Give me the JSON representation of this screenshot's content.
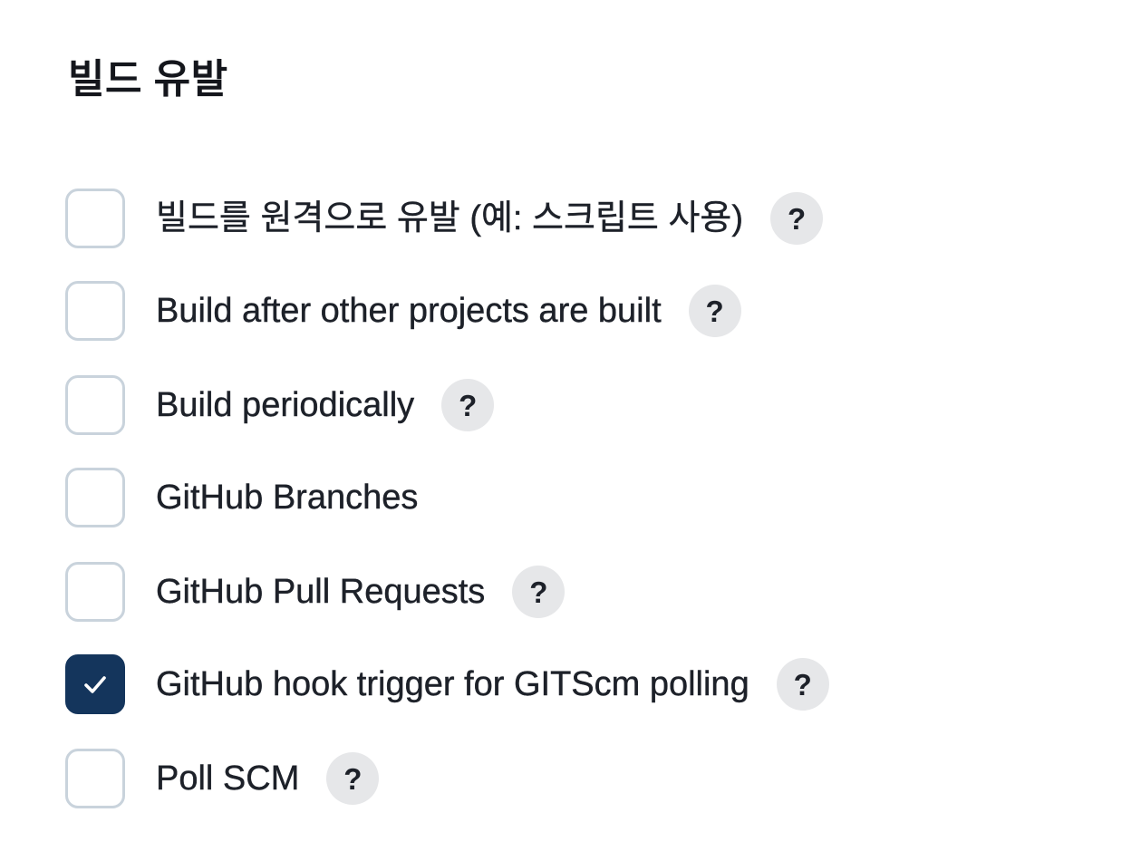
{
  "section": {
    "title": "빌드 유발"
  },
  "options": [
    {
      "label": "빌드를 원격으로 유발 (예: 스크립트 사용)",
      "checked": false,
      "help": "?"
    },
    {
      "label": "Build after other projects are built",
      "checked": false,
      "help": "?"
    },
    {
      "label": "Build periodically",
      "checked": false,
      "help": "?"
    },
    {
      "label": "GitHub Branches",
      "checked": false,
      "help": null
    },
    {
      "label": "GitHub Pull Requests",
      "checked": false,
      "help": "?"
    },
    {
      "label": "GitHub hook trigger for GITScm polling",
      "checked": true,
      "help": "?"
    },
    {
      "label": "Poll SCM",
      "checked": false,
      "help": "?"
    }
  ],
  "icons": {
    "checkbox_checked": "checkmark-icon",
    "help": "help-icon"
  },
  "colors": {
    "checked_fill": "#14355c",
    "checkbox_border": "#c9d3dc",
    "help_bg": "#e6e7e9",
    "text": "#1d2129"
  }
}
